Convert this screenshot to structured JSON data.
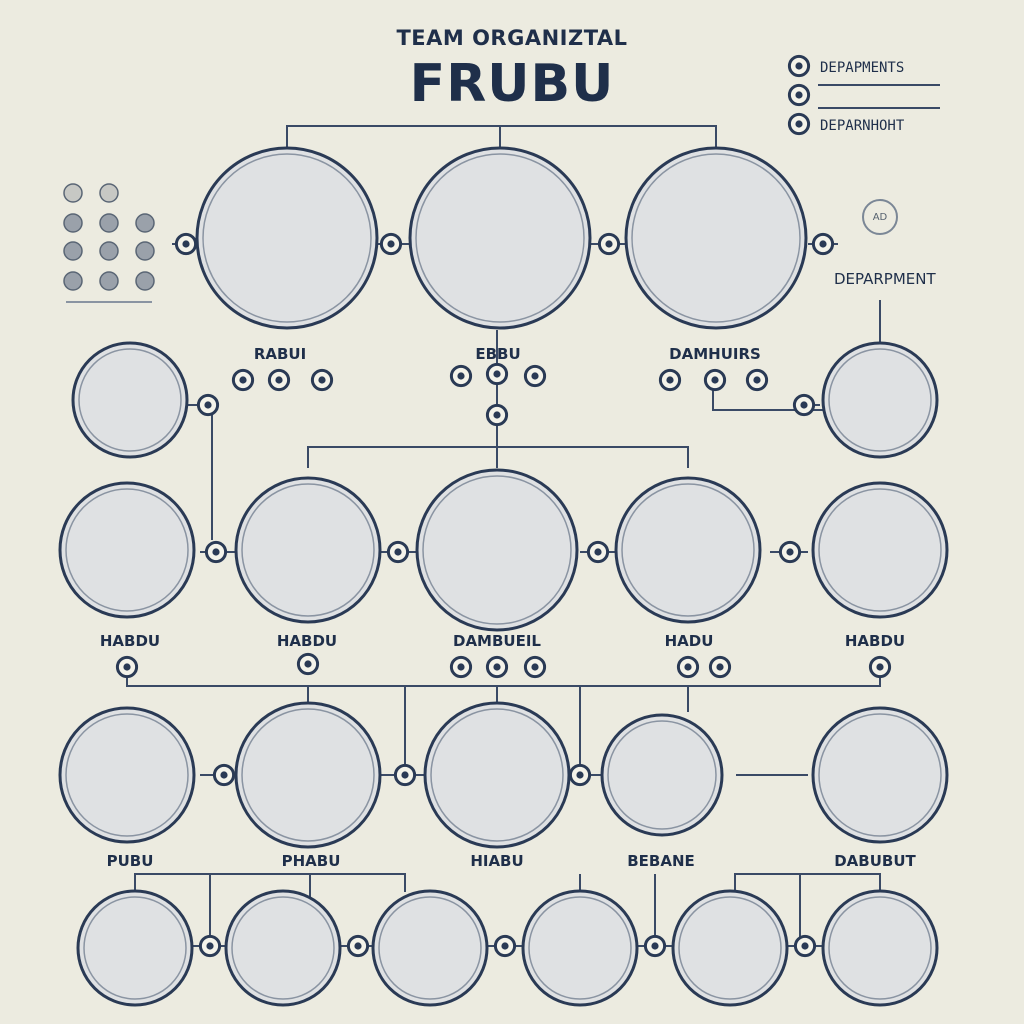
{
  "title": {
    "small": "TEAM ORGANIZTAL",
    "big": "FRUBU"
  },
  "legend": {
    "items": [
      {
        "label": "DEPAPMENTS"
      },
      {
        "label": ""
      },
      {
        "label": "DEPARNHOHT"
      }
    ]
  },
  "side_badge": {
    "text": "AD",
    "label": "DEPARPMENT"
  },
  "members": {
    "row1": [
      "RABUI",
      "EBBU",
      "DAMHUIRS"
    ],
    "row3": [
      "HABDU",
      "HABDU",
      "DAMBUEIL",
      "HADU",
      "HABDU"
    ],
    "row4": [
      "PUBU",
      "PHABU",
      "HIABU",
      "BEBANE",
      "DABUBUT"
    ]
  },
  "colors": {
    "background": "#ecebe0",
    "ink": "#1f2f4a",
    "node_fill": "#dfe1e3",
    "node_ring": "#2a3a55",
    "connector": "#3a4a66"
  }
}
